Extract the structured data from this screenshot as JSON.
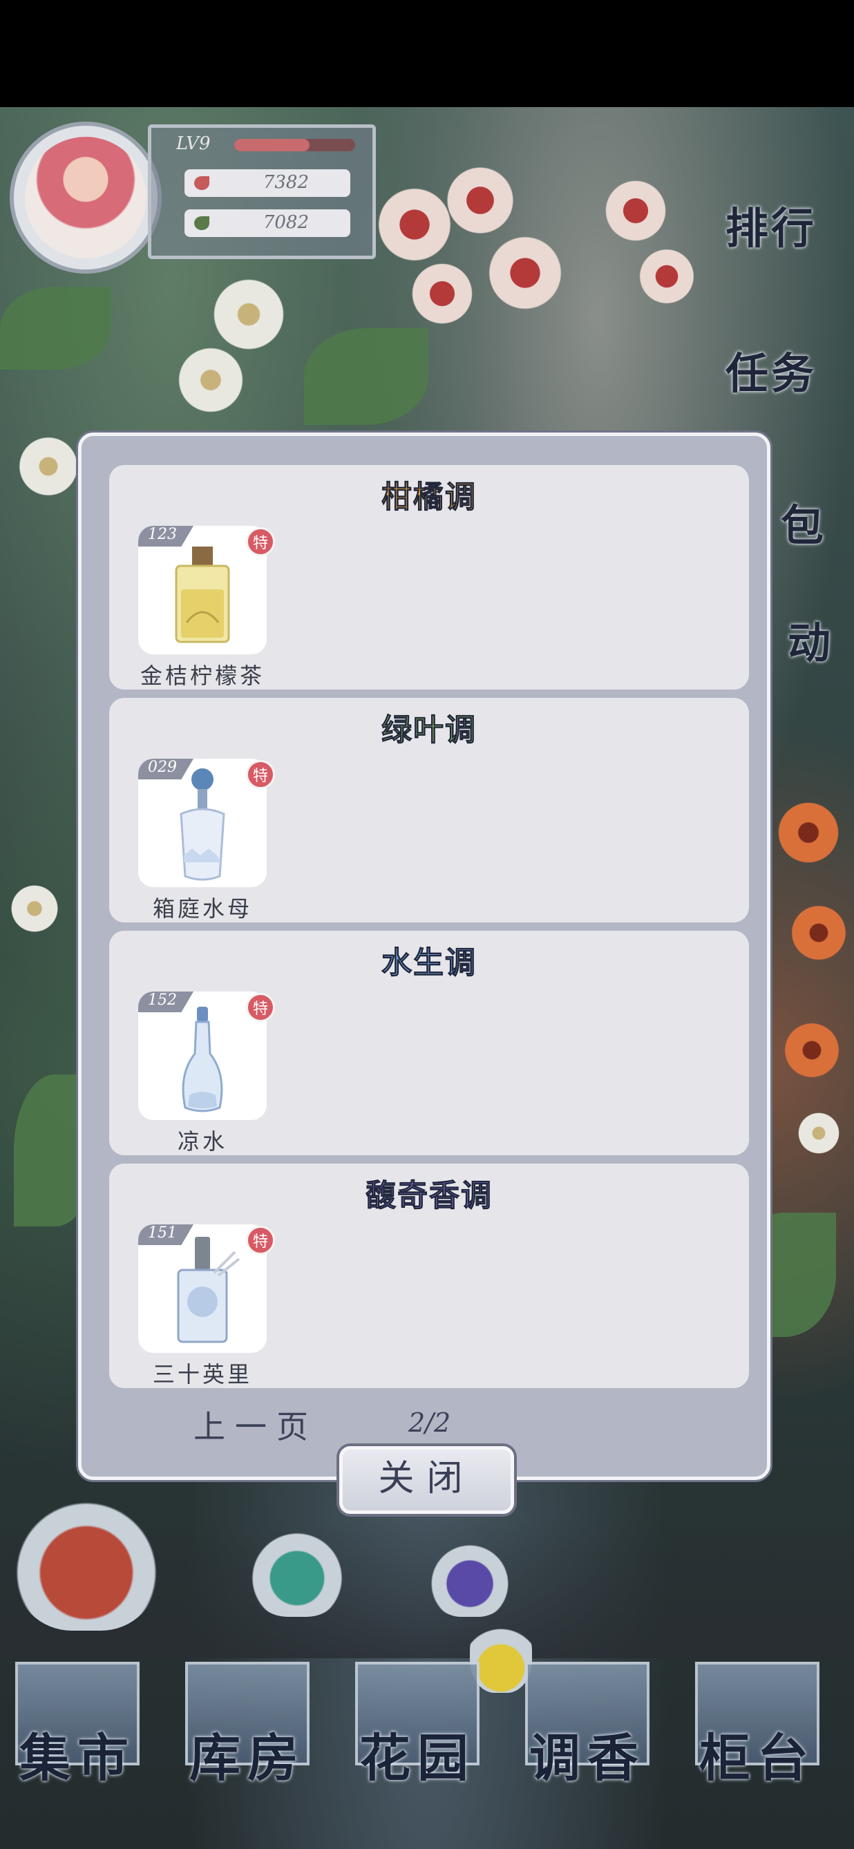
{
  "player": {
    "level": "LV9",
    "xp_fraction": 0.62,
    "currency_red": "7382",
    "currency_green": "7082"
  },
  "right_menu": {
    "rank": "排行",
    "task": "任务",
    "bag": "包",
    "event": "动"
  },
  "modal": {
    "sections": [
      {
        "title": "柑橘调",
        "title_color": "#e8a23a",
        "item": {
          "number": "123",
          "badge": "特",
          "name": "金桔柠檬茶"
        }
      },
      {
        "title": "绿叶调",
        "title_color": "#9bc46a",
        "item": {
          "number": "029",
          "badge": "特",
          "name": "箱庭水母"
        }
      },
      {
        "title": "水生调",
        "title_color": "#6f9fe0",
        "item": {
          "number": "152",
          "badge": "特",
          "name": "凉水"
        }
      },
      {
        "title": "馥奇香调",
        "title_color": "#8a78d8",
        "item": {
          "number": "151",
          "badge": "特",
          "name": "三十英里"
        }
      }
    ],
    "pager": {
      "prev_label": "上一页",
      "page": "2/2"
    },
    "close_label": "关闭"
  },
  "bottom_nav": [
    "集市",
    "库房",
    "花园",
    "调香",
    "柜台"
  ],
  "icons": [
    "heart-icon",
    "leaf-icon",
    "perfume-bottle-icon"
  ]
}
